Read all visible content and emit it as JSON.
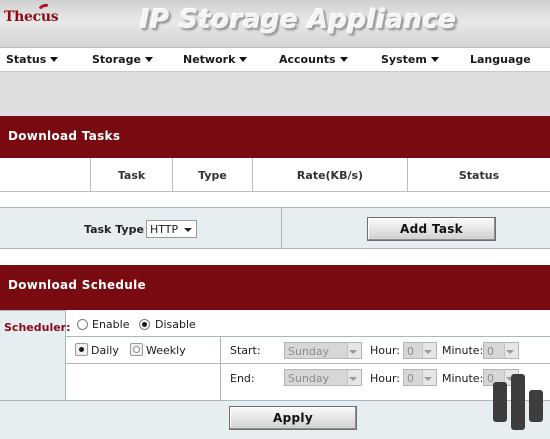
{
  "header": {
    "logo": "Thecus",
    "title": "IP Storage Appliance"
  },
  "menu": [
    {
      "label": "Status",
      "has_arrow": true
    },
    {
      "label": "Storage",
      "has_arrow": true
    },
    {
      "label": "Network",
      "has_arrow": true
    },
    {
      "label": "Accounts",
      "has_arrow": true
    },
    {
      "label": "System",
      "has_arrow": true
    },
    {
      "label": "Language",
      "has_arrow": false
    }
  ],
  "download_tasks": {
    "title": "Download Tasks",
    "columns": [
      "Task",
      "Type",
      "Rate(KB/s)",
      "Status"
    ],
    "task_type_label": "Task Type",
    "task_type_value": "HTTP",
    "add_task_label": "Add Task"
  },
  "schedule": {
    "title": "Download Schedule",
    "scheduler_label": "Scheduler:",
    "enable_label": "Enable",
    "disable_label": "Disable",
    "enabled": false,
    "daily_label": "Daily",
    "weekly_label": "Weekly",
    "frequency": "daily",
    "start_label": "Start:",
    "end_label": "End:",
    "start_day": "Sunday",
    "end_day": "Sunday",
    "hour_label": "Hour:",
    "minute_label": "Minute:",
    "start_hour": "0",
    "start_minute": "0",
    "end_hour": "0",
    "end_minute": "0",
    "apply_label": "Apply"
  },
  "colors": {
    "section_bar": "#7a0a12",
    "scheduler_label": "#8a0a17",
    "panel_bg": "#e7eef1"
  }
}
